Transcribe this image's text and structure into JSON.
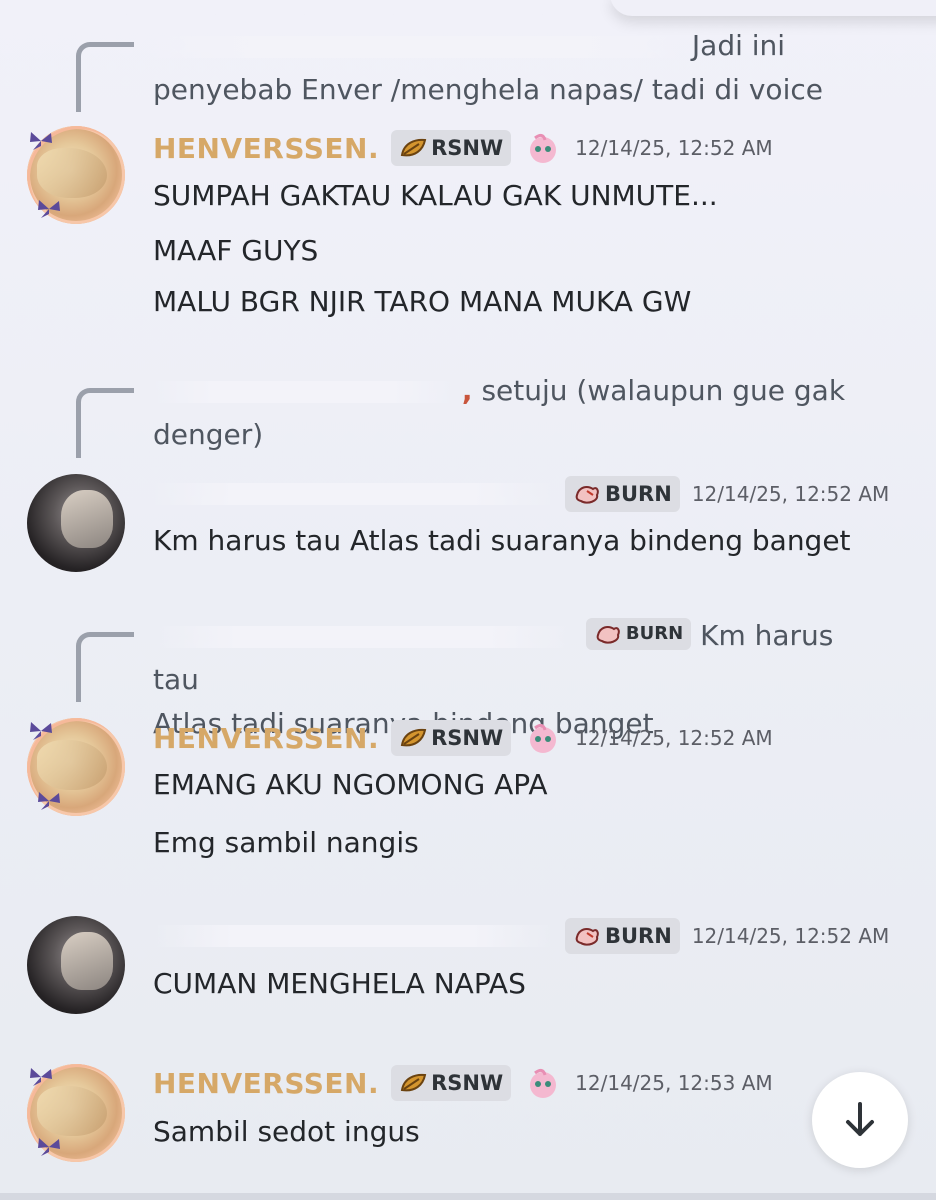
{
  "messages": [
    {
      "reply_text": "Jadi ini penyebab Enver /menghela napas/ tadi di voice",
      "reply_text_line1": "Jadi ini",
      "reply_text_line2": "penyebab Enver /menghela napas/ tadi di voice",
      "username": "HENVERSSEN.",
      "tag": "RSNW",
      "timestamp": "12/14/25, 12:52 AM",
      "lines": [
        "SUMPAH GAKTAU KALAU GAK UNMUTE...",
        "MAAF GUYS",
        "MALU BGR NJIR TARO MANA MUKA GW"
      ]
    },
    {
      "reply_suffix": ",",
      "reply_text_line1": "setuju (walaupun gue gak",
      "reply_text_line2": "denger)",
      "tag": "BURN",
      "timestamp": "12/14/25, 12:52 AM",
      "lines": [
        "Km harus tau Atlas tadi suaranya bindeng banget"
      ]
    },
    {
      "reply_tag": "BURN",
      "reply_text_line1": "Km harus tau",
      "reply_text_line2": "Atlas tadi suaranya bindeng banget",
      "username": "HENVERSSEN.",
      "tag": "RSNW",
      "timestamp": "12/14/25, 12:52 AM",
      "lines": [
        "EMANG AKU NGOMONG APA",
        "Emg sambil nangis"
      ]
    },
    {
      "tag": "BURN",
      "timestamp": "12/14/25, 12:52 AM",
      "lines": [
        "CUMAN MENGHELA NAPAS"
      ]
    },
    {
      "username": "HENVERSSEN.",
      "tag": "RSNW",
      "timestamp": "12/14/25, 12:53 AM",
      "lines": [
        "Sambil sedot ingus"
      ]
    }
  ],
  "colors": {
    "henverssen_name": "#d6a867",
    "burn_name": "#c8553c",
    "tag_bg": "#dcdde3",
    "background": "#eceef5"
  },
  "icons": {
    "rsnw_tag": "leaf-icon",
    "burn_tag": "burn-icon",
    "role": "jigglypuff-icon",
    "scroll": "arrow-down-icon"
  }
}
